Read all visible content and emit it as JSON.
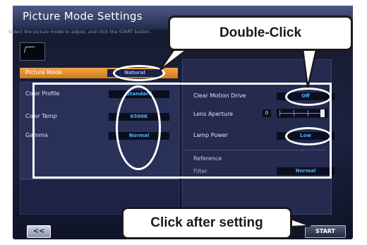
{
  "window": {
    "title": "Picture Mode Settings",
    "instruction": "Select the picture mode to adjust, and click the START button."
  },
  "picture_mode": {
    "label": "Picture Mode",
    "value": "Natural"
  },
  "left_settings": [
    {
      "label": "Color Profile",
      "value": "Standard"
    },
    {
      "label": "Color Temp",
      "value": "6500K"
    },
    {
      "label": "Gamma",
      "value": "Normal"
    }
  ],
  "right_settings": [
    {
      "label": "Clear Motion Drive",
      "value": "Off"
    },
    {
      "label": "Lens Aperture",
      "value": "0"
    },
    {
      "label": "Lamp Power",
      "value": "Low"
    }
  ],
  "reference": {
    "heading": "Reference",
    "filter_label": "Filter",
    "filter_value": "Normal"
  },
  "buttons": {
    "back": "<<",
    "start": "START"
  },
  "annotations": {
    "double_click": "Double-Click",
    "click_after": "Click after setting"
  }
}
